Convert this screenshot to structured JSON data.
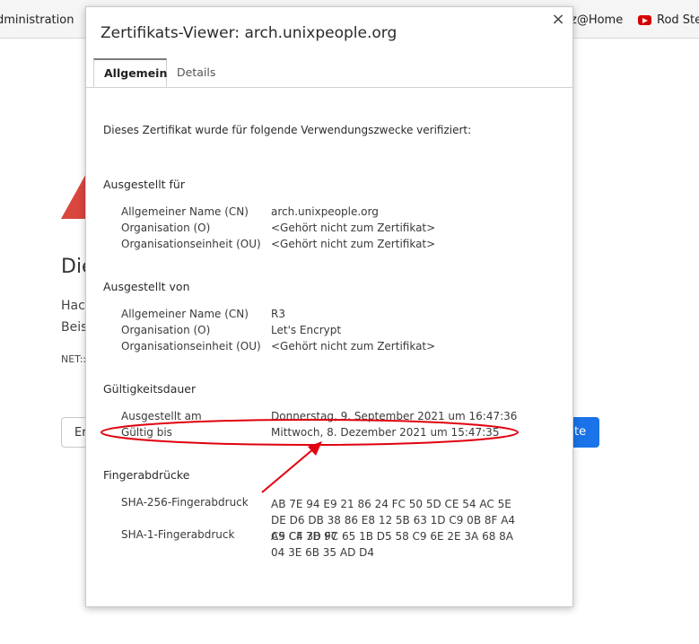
{
  "browser": {
    "bookmark_left": "dministration",
    "bookmark_right": "z@Home",
    "bookmark_youtube": "Rod Ste"
  },
  "background_page": {
    "heading": "Die",
    "text_line1": "Hac",
    "text_line2": "Beis",
    "small_text": "NET::",
    "left_button": "Er",
    "right_button": "te",
    "accent_color": "#1a73e8",
    "warning_color": "#d9463e"
  },
  "dialog": {
    "title": "Zertifikats-Viewer: arch.unixpeople.org",
    "close_icon": "×",
    "tabs": [
      {
        "label": "Allgemein",
        "selected": true
      },
      {
        "label": "Details",
        "selected": false
      }
    ],
    "verified_text": "Dieses Zertifikat wurde für folgende Verwendungszwecke verifiziert:",
    "issued_to": {
      "heading": "Ausgestellt für",
      "rows": [
        {
          "label": "Allgemeiner Name (CN)",
          "value": "arch.unixpeople.org"
        },
        {
          "label": "Organisation (O)",
          "value": "<Gehört nicht zum Zertifikat>"
        },
        {
          "label": "Organisationseinheit (OU)",
          "value": "<Gehört nicht zum Zertifikat>"
        }
      ]
    },
    "issued_by": {
      "heading": "Ausgestellt von",
      "rows": [
        {
          "label": "Allgemeiner Name (CN)",
          "value": "R3"
        },
        {
          "label": "Organisation (O)",
          "value": "Let's Encrypt"
        },
        {
          "label": "Organisationseinheit (OU)",
          "value": "<Gehört nicht zum Zertifikat>"
        }
      ]
    },
    "validity": {
      "heading": "Gültigkeitsdauer",
      "rows": [
        {
          "label": "Ausgestellt am",
          "value": "Donnerstag, 9. September 2021 um 16:47:36"
        },
        {
          "label": "Gültig bis",
          "value": "Mittwoch, 8. Dezember 2021 um 15:47:35"
        }
      ]
    },
    "fingerprints": {
      "heading": "Fingerabdrücke",
      "rows": [
        {
          "label": "SHA-256-Fingerabdruck",
          "value": "AB 7E 94 E9 21 86 24 FC 50 5D CE 54 AC 5E DE D6 DB 38 86 E8 12 5B 63 1D C9 0B 8F A4 C5 CF 7D F7"
        },
        {
          "label": "SHA-1-Fingerabdruck",
          "value": "A9 C4 3B 9C 65 1B D5 58 C9 6E 2E 3A 68 8A 04 3E 6B 35 AD D4"
        }
      ]
    }
  },
  "annotation": {
    "color": "#e0000f"
  }
}
